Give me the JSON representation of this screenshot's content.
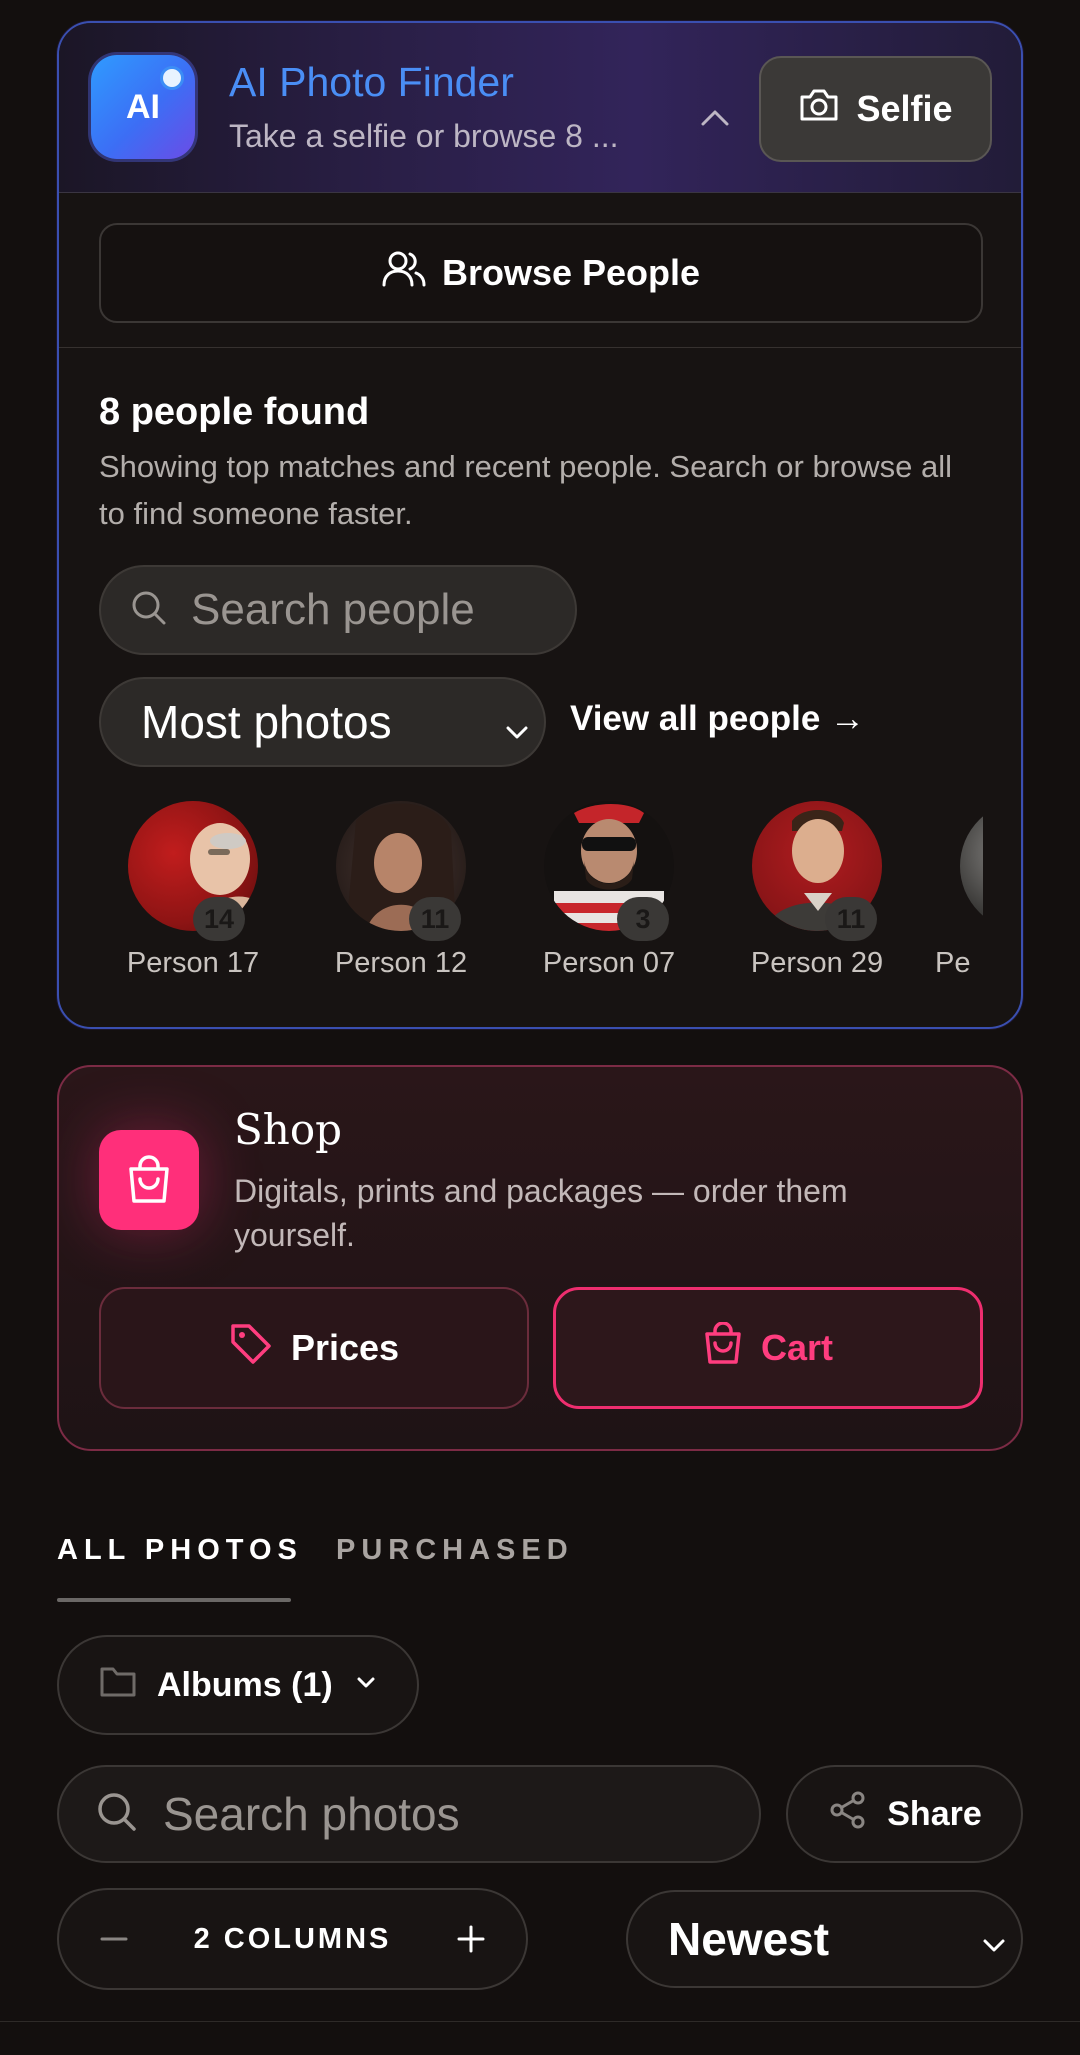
{
  "ai_finder": {
    "logo_text": "AI",
    "title": "AI Photo Finder",
    "subtitle": "Take a selfie or browse 8 ...",
    "selfie_label": "Selfie",
    "browse_label": "Browse People",
    "found_title": "8 people found",
    "found_description": "Showing top matches and recent people. Search or browse all to find someone faster.",
    "search_placeholder": "Search people",
    "sort_value": "Most photos",
    "view_all_label": "View all people →",
    "people": [
      {
        "label": "Person 17",
        "count": "14"
      },
      {
        "label": "Person 12",
        "count": "11"
      },
      {
        "label": "Person 07",
        "count": "3"
      },
      {
        "label": "Person 29",
        "count": "11"
      },
      {
        "label": "Pe",
        "count": ""
      }
    ]
  },
  "shop": {
    "title": "Shop",
    "description": "Digitals, prints and packages — order them yourself.",
    "prices_label": "Prices",
    "cart_label": "Cart"
  },
  "gallery": {
    "tabs": [
      "ALL PHOTOS",
      "PURCHASED"
    ],
    "albums_label": "Albums (1)",
    "search_placeholder": "Search photos",
    "share_label": "Share",
    "columns_label": "2 COLUMNS",
    "order_value": "Newest"
  },
  "colors": {
    "accent_blue": "#4a8ef5",
    "shop_pink": "#ff2f7a",
    "background": "#130f0e"
  }
}
